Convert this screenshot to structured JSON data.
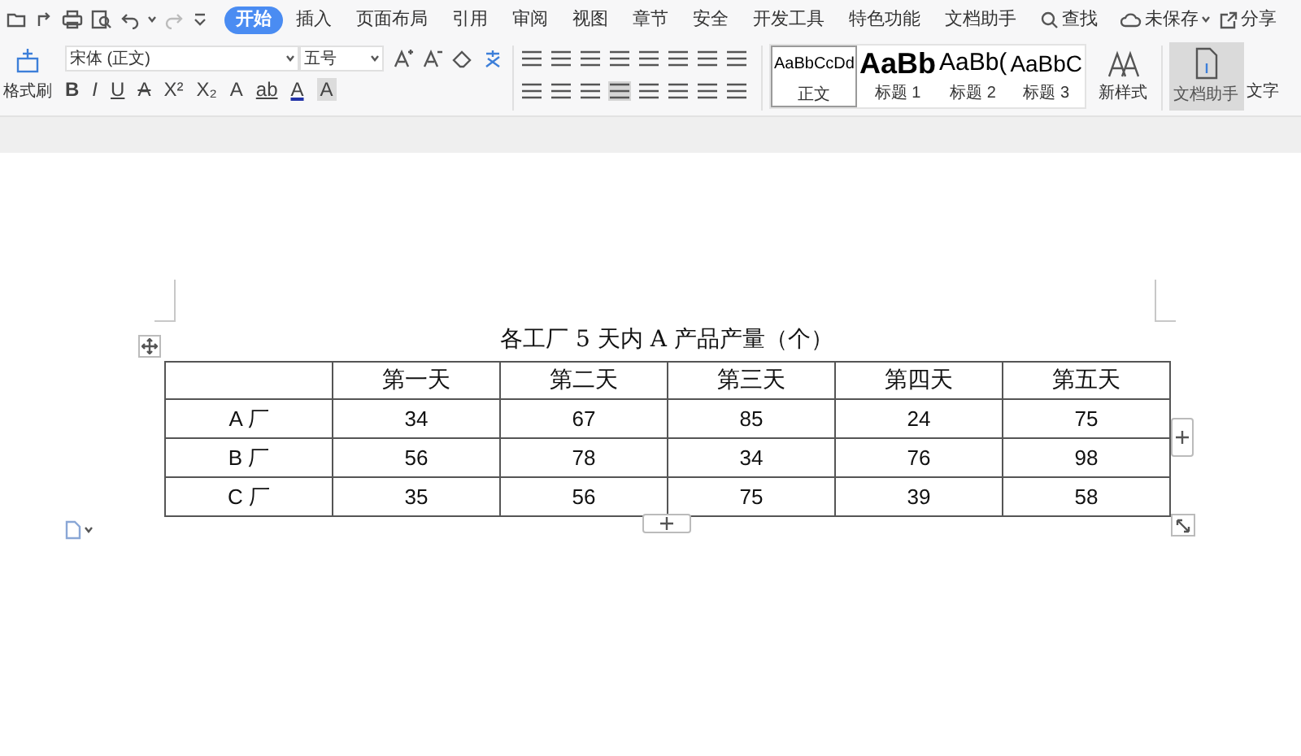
{
  "menu_tabs": [
    {
      "label": "开始",
      "selected": true
    },
    {
      "label": "插入",
      "selected": false
    },
    {
      "label": "页面布局",
      "selected": false
    },
    {
      "label": "引用",
      "selected": false
    },
    {
      "label": "审阅",
      "selected": false
    },
    {
      "label": "视图",
      "selected": false
    },
    {
      "label": "章节",
      "selected": false
    },
    {
      "label": "安全",
      "selected": false
    },
    {
      "label": "开发工具",
      "selected": false
    },
    {
      "label": "特色功能",
      "selected": false
    },
    {
      "label": "文档助手",
      "selected": false
    }
  ],
  "search": {
    "label": "查找"
  },
  "save_status": "未保存",
  "share": "分享",
  "format_painter": "格式刷",
  "font_name": "宋体 (正文)",
  "font_size": "五号",
  "font_buttons": [
    "B",
    "I",
    "U",
    "A",
    "X²",
    "X₂",
    "A",
    "ab",
    "A",
    "A"
  ],
  "styles": [
    {
      "preview": "AaBbCcDd",
      "label": "正文",
      "selected": true,
      "kind": "normal"
    },
    {
      "preview": "AaBb",
      "label": "标题 1",
      "selected": false,
      "kind": "h1"
    },
    {
      "preview": "AaBb(",
      "label": "标题 2",
      "selected": false,
      "kind": "h2"
    },
    {
      "preview": "AaBbC",
      "label": "标题 3",
      "selected": false,
      "kind": "h3"
    }
  ],
  "new_style": "新样式",
  "doc_assistant": {
    "label": "文档助手",
    "selected": true
  },
  "cut_button": "文字",
  "table": {
    "title": "各工厂 5 天内 A 产品产量（个）",
    "columns": [
      "",
      "第一天",
      "第二天",
      "第三天",
      "第四天",
      "第五天"
    ],
    "rows": [
      [
        "A 厂",
        "34",
        "67",
        "85",
        "24",
        "75"
      ],
      [
        "B 厂",
        "56",
        "78",
        "34",
        "76",
        "98"
      ],
      [
        "C 厂",
        "35",
        "56",
        "75",
        "39",
        "58"
      ]
    ]
  }
}
